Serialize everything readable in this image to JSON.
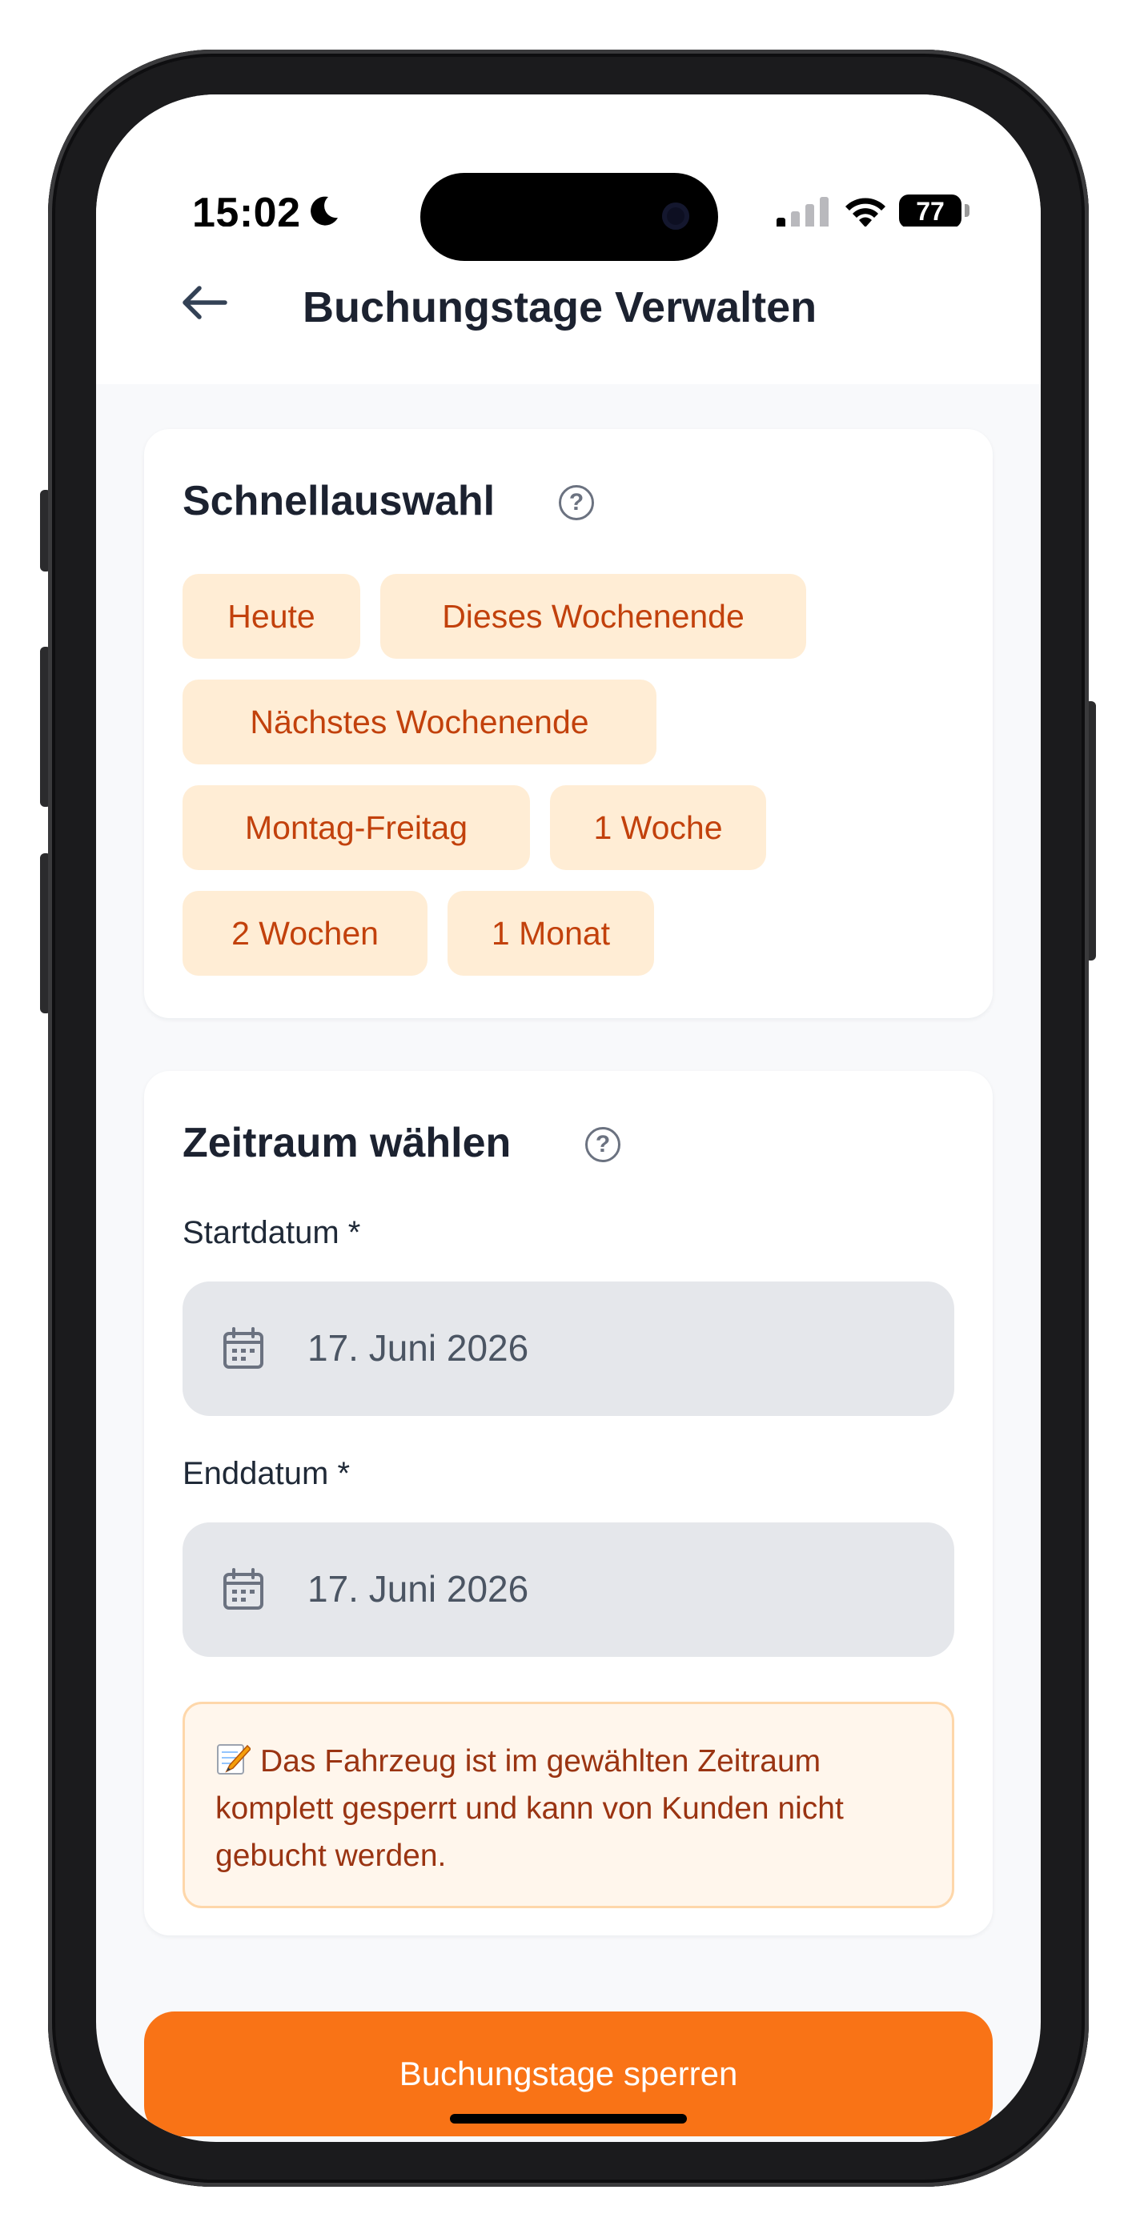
{
  "status_bar": {
    "time": "15:02",
    "battery": "77"
  },
  "header": {
    "title": "Buchungstage Verwalten"
  },
  "quick_select": {
    "title": "Schnellauswahl",
    "help_glyph": "?",
    "chips": [
      "Heute",
      "Dieses Wochenende",
      "Nächstes Wochenende",
      "Montag-Freitag",
      "1 Woche",
      "2 Wochen",
      "1 Monat"
    ]
  },
  "period": {
    "title": "Zeitraum wählen",
    "help_glyph": "?",
    "start_label": "Startdatum *",
    "start_value": "17. Juni 2026",
    "end_label": "Enddatum *",
    "end_value": "17. Juni 2026",
    "note": "Das Fahrzeug ist im gewählten Zeitraum komplett gesperrt und kann von Kunden nicht gebucht werden."
  },
  "action": {
    "label": "Buchungstage sperren"
  },
  "colors": {
    "accent": "#f97316",
    "chip_bg": "#ffedd5",
    "chip_text": "#c2410c",
    "note_bg": "#fff6ec",
    "note_border": "#fed7aa"
  },
  "icons": {
    "back": "arrow-left-icon",
    "help": "question-circle-icon",
    "calendar": "calendar-icon",
    "memo": "memo-pencil-icon"
  }
}
